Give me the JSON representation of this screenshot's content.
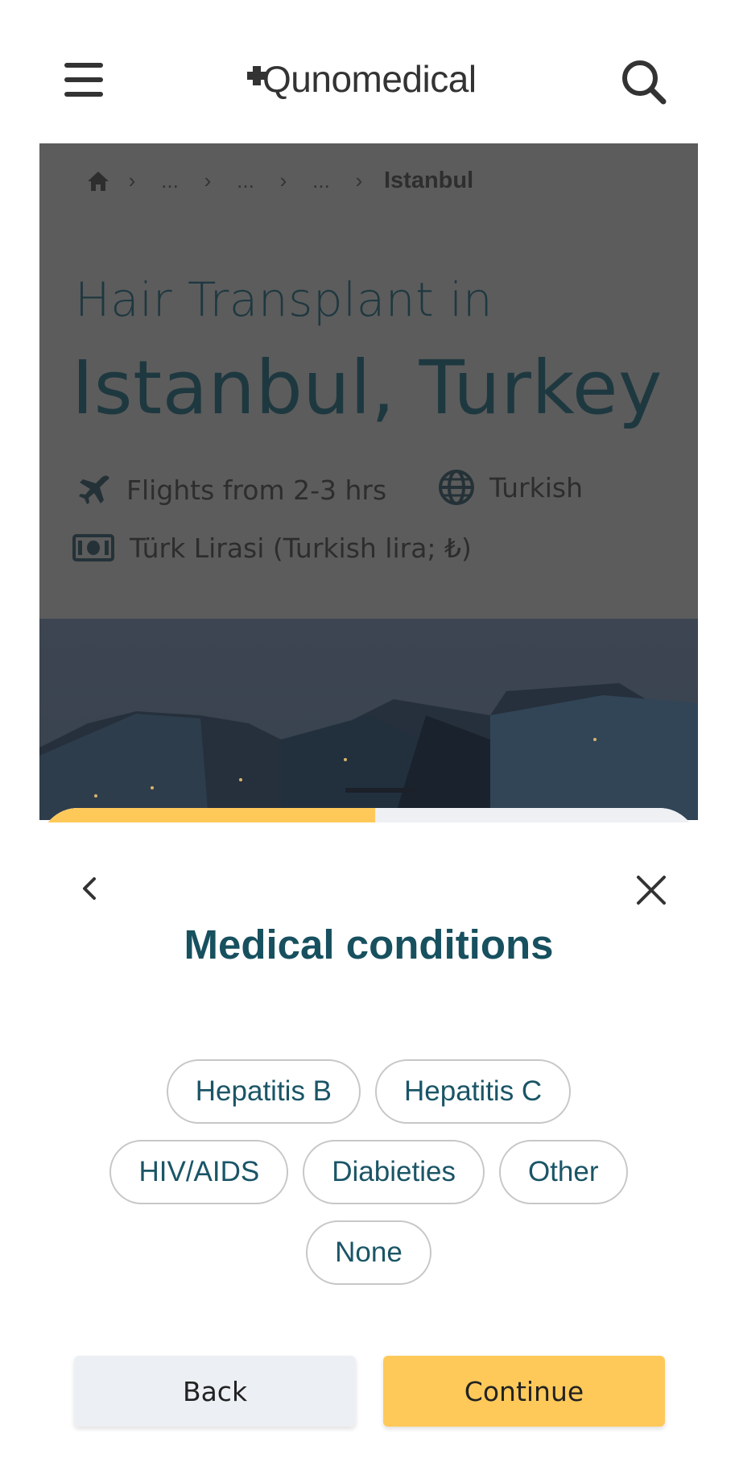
{
  "header": {
    "logo_text": "Qunomedical",
    "menu_icon": "hamburger-menu-icon",
    "search_icon": "search-icon"
  },
  "breadcrumb": {
    "home_icon": "home-icon",
    "items": [
      "...",
      "...",
      "..."
    ],
    "current": "Istanbul"
  },
  "hero": {
    "subtitle": "Hair Transplant in",
    "title": "Istanbul, Turkey",
    "facts": {
      "flights": "Flights from 2-3 hrs",
      "language": "Turkish",
      "currency": "Türk Lirasi (Turkish lira; ₺)"
    },
    "overlay_color": "#5c5c5c"
  },
  "modal": {
    "title": "Medical conditions",
    "progress_fraction": 0.51,
    "chips": [
      [
        "Hepatitis B",
        "Hepatitis C"
      ],
      [
        "HIV/AIDS",
        "Diabieties",
        "Other"
      ],
      [
        "None"
      ]
    ],
    "back_label": "Back",
    "continue_label": "Continue",
    "accent_color": "#ffc95a",
    "title_color": "#17505f"
  }
}
